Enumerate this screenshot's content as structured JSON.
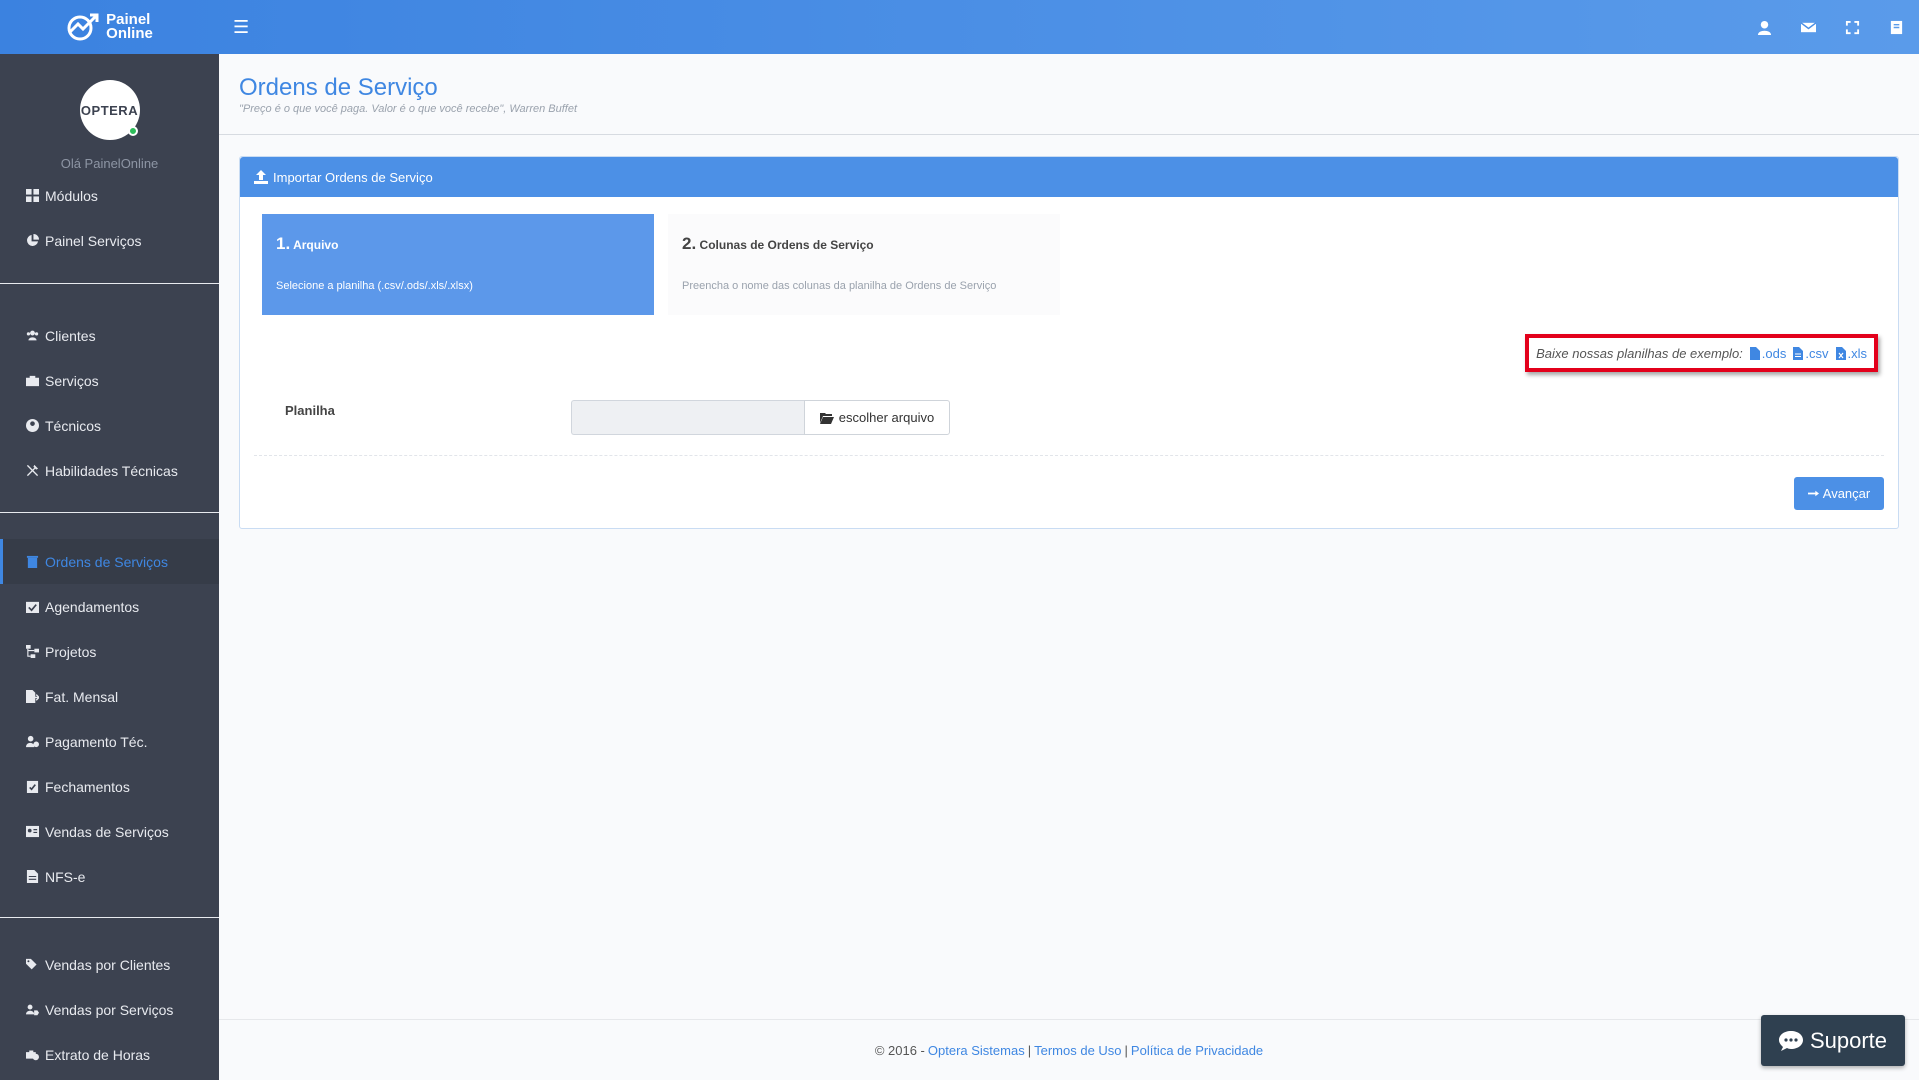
{
  "brand": {
    "line1": "Painel",
    "line2": "Online"
  },
  "topbar": {
    "icons": [
      "user-icon",
      "envelope-icon",
      "fullscreen-icon",
      "book-icon"
    ]
  },
  "profile": {
    "avatar_text": "OPTERA",
    "greeting": "Olá PainelOnline"
  },
  "sidebar": {
    "group1": [
      {
        "label": "Módulos",
        "icon": "th-large-icon"
      },
      {
        "label": "Painel Serviços",
        "icon": "pie-chart-icon"
      }
    ],
    "group2": [
      {
        "label": "Clientes",
        "icon": "users-icon"
      },
      {
        "label": "Serviços",
        "icon": "briefcase-icon"
      },
      {
        "label": "Técnicos",
        "icon": "user-circle-icon"
      },
      {
        "label": "Habilidades Técnicas",
        "icon": "tools-icon"
      }
    ],
    "group3": [
      {
        "label": "Ordens de Serviços",
        "icon": "trash-icon",
        "active": true
      },
      {
        "label": "Agendamentos",
        "icon": "calendar-check-icon"
      },
      {
        "label": "Projetos",
        "icon": "sitemap-icon"
      },
      {
        "label": "Fat. Mensal",
        "icon": "file-export-icon"
      },
      {
        "label": "Pagamento Téc.",
        "icon": "user-clock-icon"
      },
      {
        "label": "Fechamentos",
        "icon": "clipboard-check-icon"
      },
      {
        "label": "Vendas de Serviços",
        "icon": "id-card-icon"
      },
      {
        "label": "NFS-e",
        "icon": "file-text-icon"
      }
    ],
    "group4": [
      {
        "label": "Vendas por Clientes",
        "icon": "tags-icon"
      },
      {
        "label": "Vendas por Serviços",
        "icon": "user-tag-icon"
      },
      {
        "label": "Extrato de Horas",
        "icon": "business-time-icon"
      }
    ]
  },
  "page": {
    "title": "Ordens de Serviço",
    "subtitle": "\"Preço é o que você paga. Valor é o que você recebe\", Warren Buffet"
  },
  "box": {
    "header": "Importar Ordens de Serviço",
    "steps": [
      {
        "num": "1.",
        "title": "Arquivo",
        "desc": "Selecione a planilha (.csv/.ods/.xls/.xlsx)",
        "active": true
      },
      {
        "num": "2.",
        "title": "Colunas de Ordens de Serviço",
        "desc": "Preencha o nome das colunas da planilha de Ordens de Serviço",
        "active": false
      }
    ],
    "examples": {
      "label": "Baixe nossas planilhas de exemplo:",
      "links": [
        ".ods",
        ".csv",
        ".xls"
      ]
    },
    "field_label": "Planilha",
    "file_button": "escolher arquivo",
    "next_button": "Avançar"
  },
  "footer": {
    "copyright": "© 2016 -",
    "company": "Optera Sistemas",
    "sep": "|",
    "terms": "Termos de Uso",
    "privacy": "Política de Privacidade"
  },
  "support": {
    "label": "Suporte"
  },
  "colors": {
    "primary": "#3f87e2",
    "sidebar": "#3c4250",
    "highlight": "#e3001b",
    "support": "#2f4050"
  }
}
